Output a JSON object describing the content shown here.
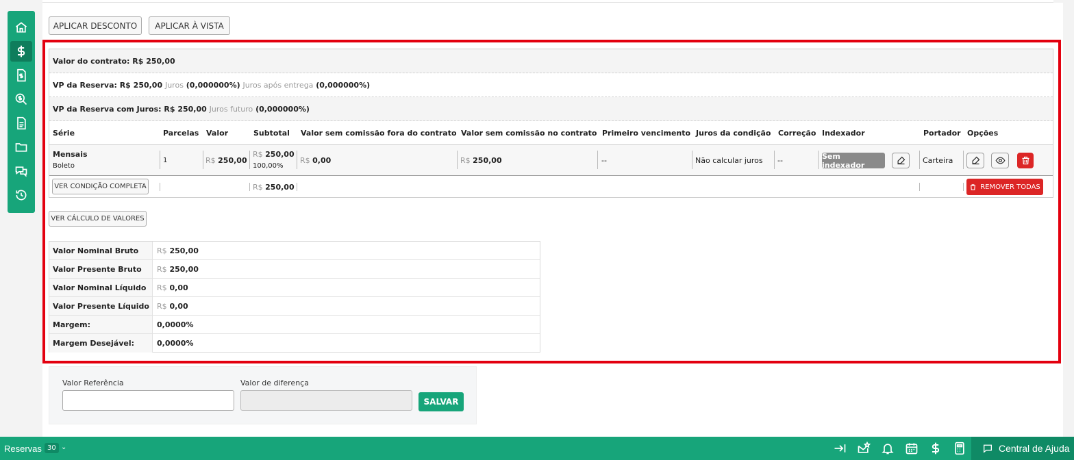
{
  "sidebar": {
    "items": [
      {
        "icon": "home-icon",
        "active": false
      },
      {
        "icon": "dollar-icon",
        "active": true
      },
      {
        "icon": "invoice-icon",
        "active": false
      },
      {
        "icon": "money-search-icon",
        "active": false
      },
      {
        "icon": "document-icon",
        "active": false
      },
      {
        "icon": "folder-icon",
        "active": false
      },
      {
        "icon": "chat-icon",
        "active": false
      },
      {
        "icon": "history-icon",
        "active": false
      }
    ]
  },
  "toolbar": {
    "apply_discount": "APLICAR DESCONTO",
    "apply_cash": "APLICAR À VISTA"
  },
  "summary": {
    "contract_value": "Valor do contrato: R$ 250,00",
    "vp_reserve": "VP da Reserva: R$ 250,00",
    "juros_label": "Juros",
    "juros_value": "(0,000000%)",
    "juros_after_label": "Juros após entrega",
    "juros_after_value": "(0,000000%)",
    "vp_reserve_interest": "VP da Reserva com Juros: R$ 250,00",
    "juros_future_label": "Juros futuro",
    "juros_future_value": "(0,000000%)"
  },
  "table": {
    "headers": {
      "serie": "Série",
      "parcelas": "Parcelas",
      "valor": "Valor",
      "subtotal": "Subtotal",
      "sem_comissao_fora": "Valor sem comissão fora do contrato",
      "sem_comissao_no": "Valor sem comissão no contrato",
      "primeiro_vencimento": "Primeiro vencimento",
      "juros_condicao": "Juros da condição",
      "correcao": "Correção",
      "indexador": "Indexador",
      "portador": "Portador",
      "opcoes": "Opções"
    },
    "row": {
      "serie": "Mensais",
      "serie_sub": "Boleto",
      "parcelas": "1",
      "currency": "R$",
      "valor": "250,00",
      "subtotal": "250,00",
      "subtotal_pct": "100,00%",
      "sem_comissao_fora": "0,00",
      "sem_comissao_no": "250,00",
      "primeiro_vencimento": "--",
      "juros_condicao": "Não calcular juros",
      "correcao": "--",
      "indexador": "Sem indexador",
      "portador": "Carteira"
    },
    "footer": {
      "ver_condicao": "VER CONDIÇÃO COMPLETA",
      "currency": "R$",
      "subtotal": "250,00",
      "remover_todas": "REMOVER TODAS"
    }
  },
  "calc_button": "VER CÁLCULO DE VALORES",
  "calc": {
    "currency": "R$",
    "rows": [
      {
        "label": "Valor Nominal Bruto",
        "value": "250,00",
        "currency": true
      },
      {
        "label": "Valor Presente Bruto",
        "value": "250,00",
        "currency": true
      },
      {
        "label": "Valor Nominal Líquido",
        "value": "0,00",
        "currency": true
      },
      {
        "label": "Valor Presente Líquido",
        "value": "0,00",
        "currency": true
      },
      {
        "label": "Margem:",
        "value": "0,0000%",
        "currency": false
      },
      {
        "label": "Margem Desejável:",
        "value": "0,0000%",
        "currency": false
      }
    ]
  },
  "reference_panel": {
    "ref_label": "Valor Referência",
    "ref_value": "",
    "diff_label": "Valor de diferença",
    "diff_value": "",
    "save": "SALVAR"
  },
  "footer": {
    "reservas_label": "Reservas",
    "reservas_count": "30",
    "help": "Central de Ajuda"
  },
  "colors": {
    "brand": "#17a57a",
    "highlight": "#e3000f",
    "danger": "#dc2626"
  }
}
